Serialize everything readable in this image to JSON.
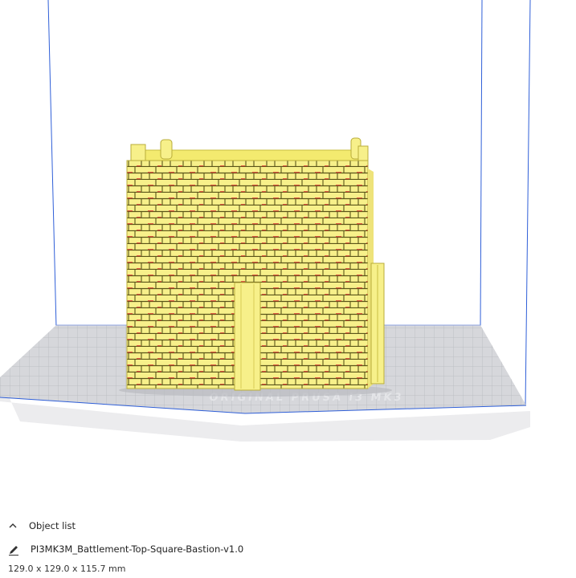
{
  "viewport": {
    "scene": "build-plate-3d-view",
    "plate_label": "ORIGINAL PRUSA i3 MK3",
    "model_color": "#f7f08a",
    "overhang_color": "#d42a2a",
    "build_volume_line_color": "#2f5fd8",
    "plate_color": "#cfd1d6"
  },
  "object_list": {
    "toggle_icon": "chevron-up-icon",
    "label": "Object list",
    "edit_icon": "pencil-icon",
    "object_name": "PI3MK3M_Battlement-Top-Square-Bastion-v1.0",
    "dimensions": "129.0 x 129.0 x 115.7 mm"
  }
}
